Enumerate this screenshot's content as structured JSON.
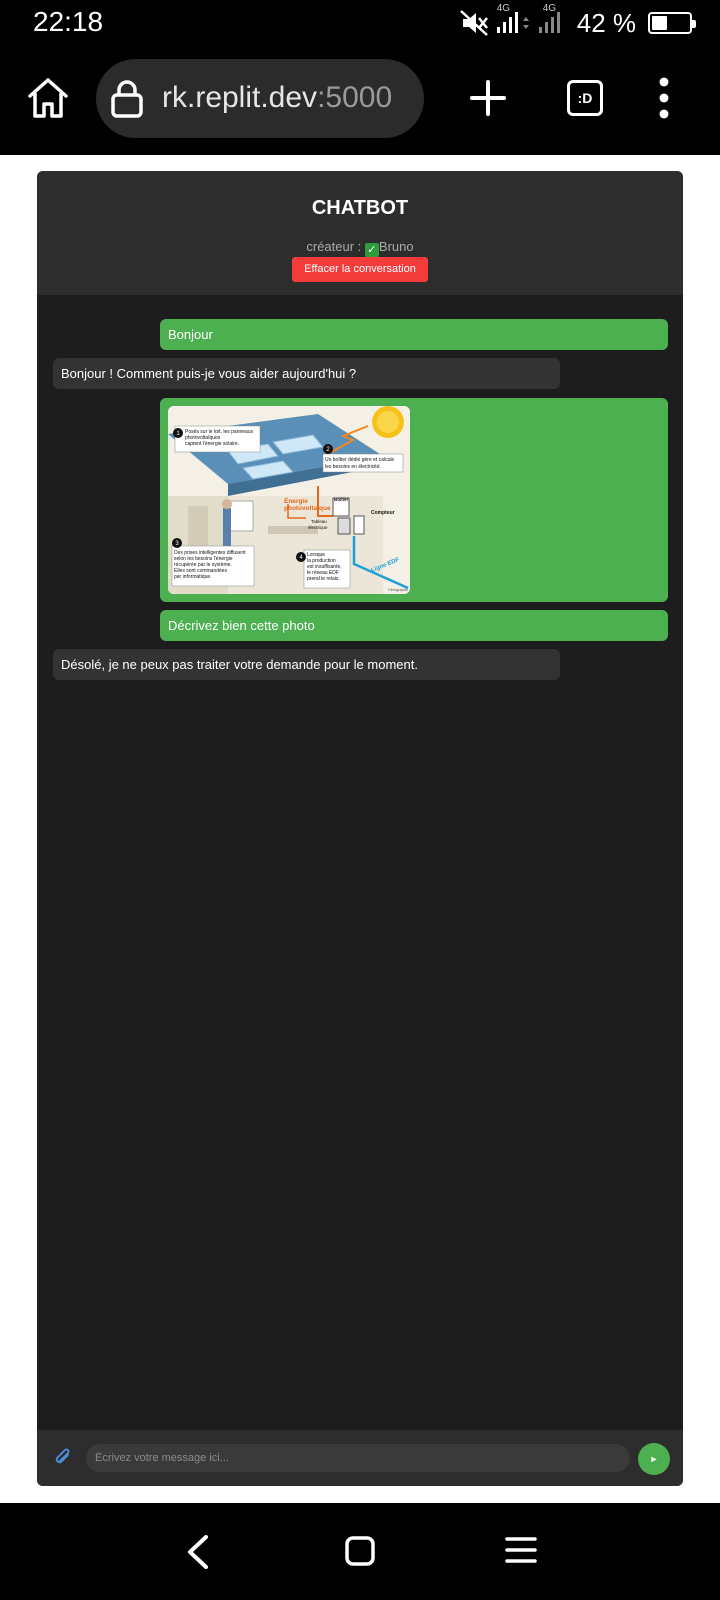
{
  "status_bar": {
    "time": "22:18",
    "network_1": "4G",
    "network_2": "4G",
    "battery_percent": "42 %",
    "battery_level": 0.42,
    "icons": [
      "mute-icon",
      "signal-icon",
      "signal-icon",
      "battery-icon"
    ]
  },
  "browser": {
    "url_host": "rk.replit.dev",
    "url_port": ":5000",
    "tabs_label": ":D",
    "icons": [
      "home-icon",
      "lock-icon",
      "plus-icon",
      "tabs-icon",
      "more-vert-icon"
    ]
  },
  "app": {
    "title": "CHATBOT",
    "creator_prefix": "créateur : ",
    "creator_check": "✓",
    "creator_name": "Bruno",
    "clear_label": "Effacer la conversation"
  },
  "messages": [
    {
      "role": "user",
      "text": "Bonjour"
    },
    {
      "role": "bot",
      "text": "Bonjour ! Comment puis-je vous aider aujourd'hui ?"
    },
    {
      "role": "user",
      "type": "image"
    },
    {
      "role": "user",
      "text": "Décrivez bien cette photo"
    },
    {
      "role": "bot",
      "text": "Désolé, je ne peux pas traiter votre demande pour le moment."
    }
  ],
  "image_labels": {
    "n1": "1",
    "t1a": "Posés sur le toit, les panneaux",
    "t1b": "photovoltaïques",
    "t1c": "captent l'énergie solaire.",
    "n2": "2",
    "t2a": "Un boîtier dédié gère et calcule",
    "t2b": "les besoins en électricité.",
    "energie_a": "Énergie",
    "energie_b": "photovoltaïque",
    "boitier": "Boîtier",
    "compteur": "Compteur",
    "tableau_a": "Tableau",
    "tableau_b": "électrique",
    "n3": "3",
    "t3a": "Des prises intelligentes diffusent",
    "t3b": "selon les besoins l'énergie",
    "t3c": "récupérée par le système.",
    "t3d": "Elles sont commandées",
    "t3e": "par informatique.",
    "n4": "4",
    "t4a": "Lorsque",
    "t4b": "la production",
    "t4c": "est insuffisante,",
    "t4d": "le réseau EDF",
    "t4e": "prend le relais.",
    "ligne": "Ligne EDF",
    "credit": "©Infographie"
  },
  "input": {
    "placeholder": "Écrivez votre message ici...",
    "send_label": "►"
  },
  "colors": {
    "user_bubble": "#4caf50",
    "bot_bubble": "#333333",
    "clear_button": "#f43c3c",
    "app_background": "#1d1d1d"
  }
}
